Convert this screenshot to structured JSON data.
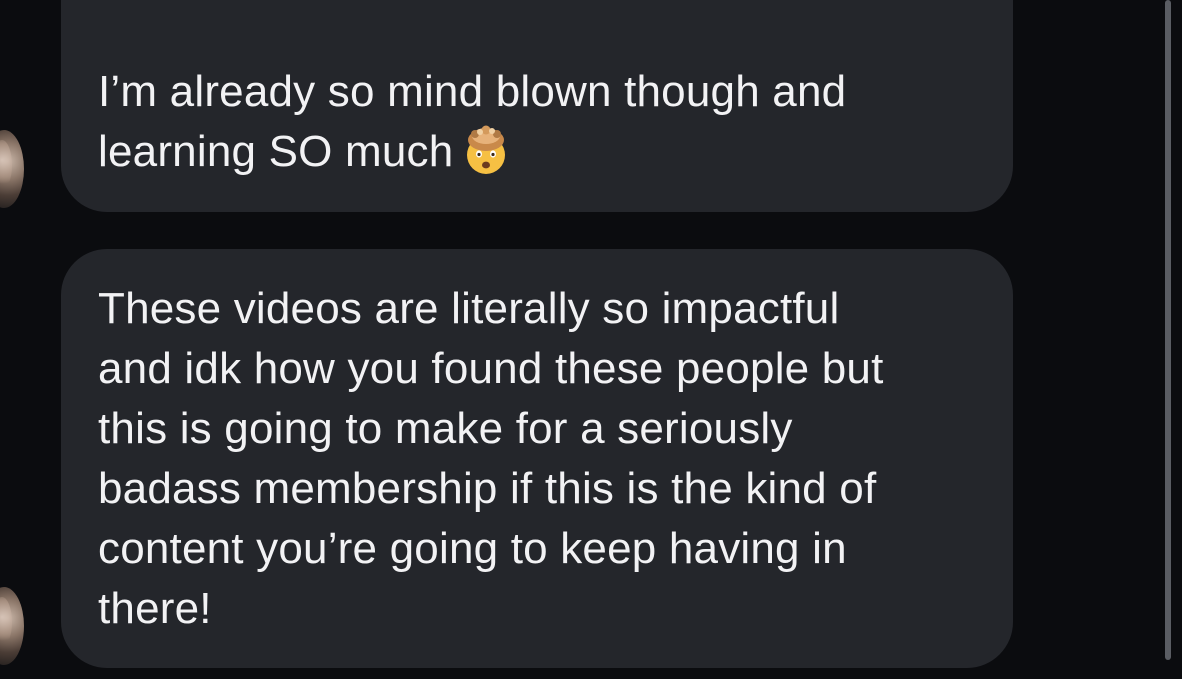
{
  "messages": [
    {
      "lines": [
        "I’m already so mind blown though and",
        "learning SO much"
      ],
      "emoji": "exploding-head-emoji"
    },
    {
      "lines": [
        "These videos are literally so impactful",
        "and idk how you found these people but",
        "this is going to make for a seriously",
        "badass membership if this is the kind of",
        "content you’re going to keep having in",
        "there!"
      ]
    }
  ],
  "colors": {
    "background": "#0b0c0f",
    "bubble": "#24262b",
    "text": "#f2f2f4",
    "scrollbar": "#5a5d63"
  }
}
